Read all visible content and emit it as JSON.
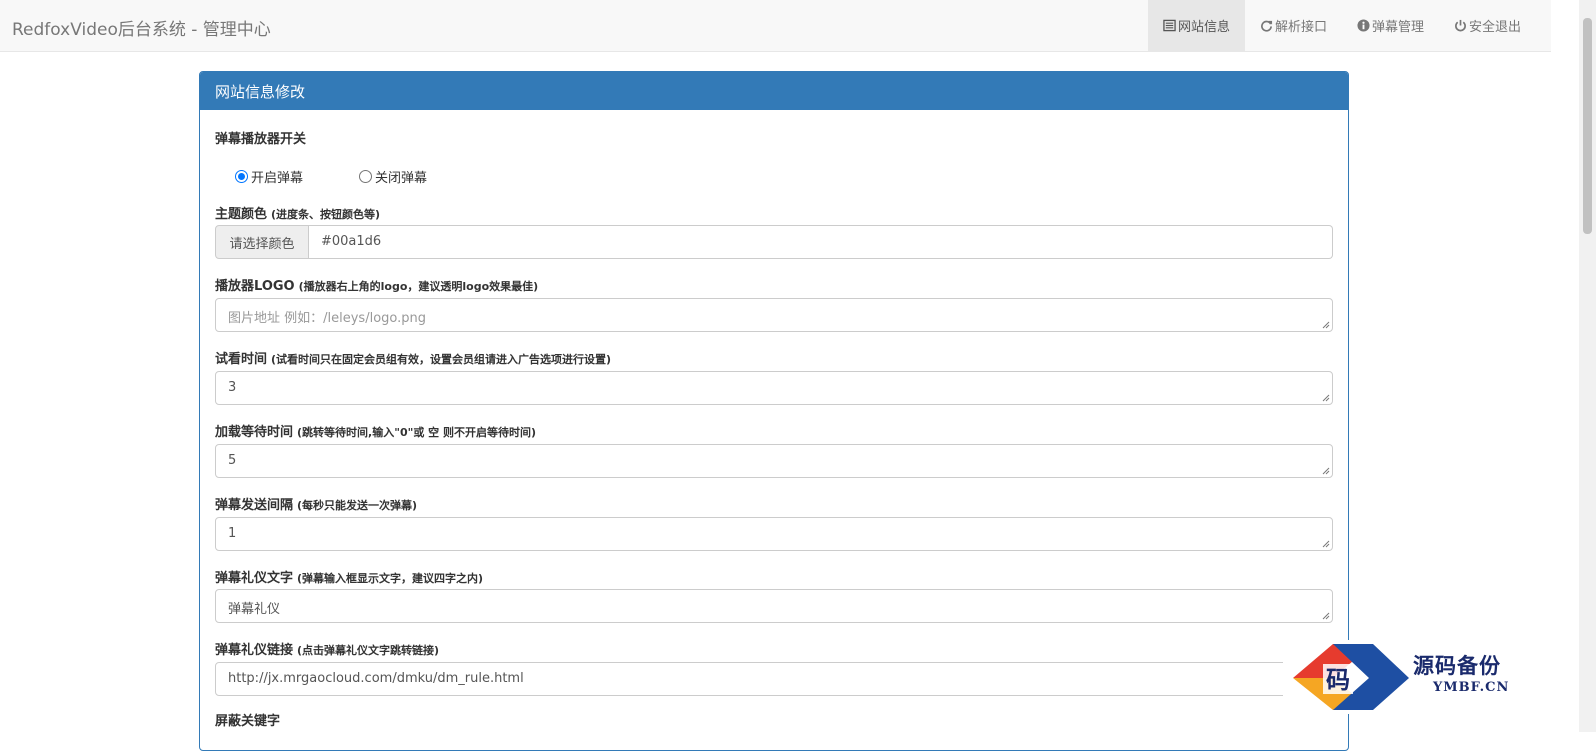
{
  "brand": "RedfoxVideo后台系统 - 管理中心",
  "nav": [
    {
      "label": "网站信息",
      "icon": "list-alt-icon",
      "active": true
    },
    {
      "label": "解析接口",
      "icon": "refresh-icon",
      "active": false
    },
    {
      "label": "弹幕管理",
      "icon": "info-sign-icon",
      "active": false
    },
    {
      "label": "安全退出",
      "icon": "off-icon",
      "active": false
    }
  ],
  "panel": {
    "title": "网站信息修改"
  },
  "form": {
    "danmaku_switch": {
      "label": "弹幕播放器开关",
      "options": [
        "开启弹幕",
        "关闭弹幕"
      ],
      "selected": "开启弹幕"
    },
    "theme_color": {
      "label": "主题颜色",
      "hint": "(进度条、按钮颜色等)",
      "addon": "请选择颜色",
      "value": "#00a1d6"
    },
    "logo": {
      "label": "播放器LOGO",
      "hint": "(播放器右上角的logo，建议透明logo效果最佳)",
      "placeholder": "图片地址 例如：/leleys/logo.png"
    },
    "trial_time": {
      "label": "试看时间",
      "hint": "(试看时间只在固定会员组有效，设置会员组请进入广告选项进行设置)",
      "value": "3"
    },
    "wait_time": {
      "label": "加载等待时间",
      "hint": "(跳转等待时间,输入\"0\"或 空 则不开启等待时间)",
      "value": "5"
    },
    "send_interval": {
      "label": "弹幕发送间隔",
      "hint": "(每秒只能发送一次弹幕)",
      "value": "1"
    },
    "etiquette_text": {
      "label": "弹幕礼仪文字",
      "hint": "(弹幕输入框显示文字，建议四字之内)",
      "value": "弹幕礼仪"
    },
    "etiquette_link": {
      "label": "弹幕礼仪链接",
      "hint": "(点击弹幕礼仪文字跳转链接)",
      "value": "http://jx.mrgaocloud.com/dmku/dm_rule.html"
    },
    "partial_label": "屏蔽关键字"
  },
  "watermark": {
    "title": "源码备份",
    "url": "YMBF.CN",
    "glyph": "码"
  }
}
